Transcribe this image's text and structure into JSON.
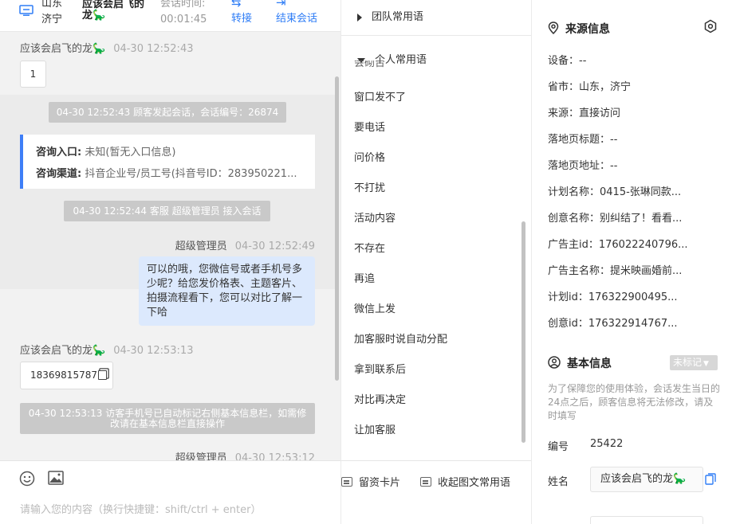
{
  "header": {
    "location_line1": "山东",
    "location_line2": "济宁",
    "visitor_name_line1": "应该会启飞的",
    "visitor_name_line2": "龙🦕",
    "timer_label": "会话时间:",
    "timer_value": "00:01:45",
    "transfer_label": "转接",
    "end_label": "结束会话"
  },
  "messages": {
    "visitor_name": "应该会启飞的龙🦕",
    "msg1_time": "04-30 12:52:43",
    "msg1_text": "1",
    "sys1": "04-30 12:52:43 顾客发起会话，会话编号：26874",
    "card_entry_label": "咨询入口:",
    "card_entry_value": "未知(暂无入口信息)",
    "card_channel_label": "咨询渠道:",
    "card_channel_value": "抖音企业号/员工号(抖音号ID：283950221...",
    "sys2": "04-30 12:52:44 客服 超级管理员 接入会话",
    "agent_name": "超级管理员",
    "agent_time1": "04-30 12:52:49",
    "agent_text": "可以的哦，您微信号或者手机号多少呢？给您发价格表、主题客片、拍摄流程看下，您可以对比了解一下哈",
    "msg2_time": "04-30 12:53:13",
    "msg2_text": "18369815787",
    "sys3": "04-30 12:53:13 访客手机号已自动标记右侧基本信息栏，如需修改请在基本信息栏直接操作",
    "agent_time2": "04-30 12:53:12"
  },
  "input": {
    "placeholder": "请输入您的内容（换行快捷键：shift/ctrl + enter）"
  },
  "phrases": {
    "team_group": "团队常用语",
    "personal_group": "个人常用语",
    "items": [
      "会砌台",
      "窗口发不了",
      "要电话",
      "问价格",
      "不打扰",
      "活动内容",
      "不存在",
      "再追",
      "微信上发",
      "加客服时说自动分配",
      "拿到联系后",
      "对比再决定",
      "让加客服"
    ],
    "action_card": "留资卡片",
    "action_collapse": "收起图文常用语"
  },
  "source_info": {
    "title": "来源信息",
    "device": "设备：--",
    "province": "省市：山东，济宁",
    "source": "来源：直接访问",
    "landing_title": "落地页标题：--",
    "landing_url": "落地页地址：--",
    "plan_name": "计划名称：0415-张琳同款...",
    "creative_name": "创意名称：别纠结了！看看...",
    "advertiser_id": "广告主id：176022240796...",
    "advertiser_name": "广告主名称：提米映画婚前...",
    "plan_id": "计划id：176322900495...",
    "creative_id": "创意id：176322914767..."
  },
  "basic_info": {
    "title": "基本信息",
    "tag": "未标记",
    "notice": "为了保障您的使用体验，会话发生当日的24点之后，顾客信息将无法修改，请及时填写",
    "number_label": "编号",
    "number_value": "25422",
    "name_label": "姓名",
    "name_value": "应该会启飞的龙🦕"
  },
  "colors": {
    "accent": "#2f7df6",
    "agent_bubble": "#dce9fd",
    "system_notice": "#c9c9c9"
  }
}
